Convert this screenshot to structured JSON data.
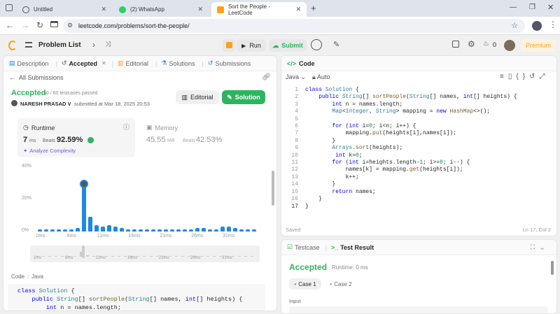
{
  "browser": {
    "tabs": [
      {
        "title": "Untitled",
        "icon": "globe-icon"
      },
      {
        "title": "(2) WhatsApp",
        "icon": "whatsapp-icon"
      },
      {
        "title": "Sort the People - LeetCode",
        "icon": "leetcode-icon"
      }
    ],
    "url": "leetcode.com/problems/sort-the-people/"
  },
  "nav": {
    "problem_list": "Problem List",
    "run": "Run",
    "submit": "Submit",
    "streak": "0",
    "premium": "Premium"
  },
  "left": {
    "tabs": [
      "Description",
      "Accepted",
      "Editorial",
      "Solutions",
      "Submissions"
    ],
    "all_submissions": "All Submissions",
    "status": "Accepted",
    "passed": "60 / 60 testcases passed",
    "user": "NARESH PRASAD V",
    "submitted": "submitted at Mar 18, 2025 20:53",
    "editorial_btn": "Editorial",
    "solution_btn": "Solution",
    "runtime_label": "Runtime",
    "runtime_value": "7",
    "runtime_unit": "ms",
    "runtime_beats_label": "Beats",
    "runtime_beats": "92.59%",
    "analyze": "Analyze Complexity",
    "memory_label": "Memory",
    "memory_value": "45.55",
    "memory_unit": "MB",
    "memory_beats_label": "Beats",
    "memory_beats": "42.53%",
    "code_label": "Code",
    "code_lang": "Java",
    "code_lines": [
      "class Solution {",
      "    public String[] sortPeople(String[] names, int[] heights) {",
      "        int n = names.length;"
    ]
  },
  "chart_data": {
    "type": "bar",
    "yticks": [
      "40%",
      "20%",
      "0%"
    ],
    "ylim": [
      0,
      40
    ],
    "xticks": [
      "1ms",
      "6ms",
      "11ms",
      "16ms",
      "21ms",
      "26ms",
      "31ms"
    ],
    "values": [
      1,
      1,
      1,
      1,
      1,
      1,
      2,
      30,
      9,
      4,
      3,
      4,
      3,
      2,
      1,
      1,
      1,
      1,
      1,
      1,
      1,
      1,
      1,
      1,
      1,
      2,
      2,
      1,
      1,
      3,
      3,
      2,
      1,
      1,
      1
    ],
    "highlight_index": 7
  },
  "editor": {
    "title": "Code",
    "lang": "Java",
    "auto": "Auto",
    "status": "Saved",
    "cursor": "Ln 17, Col 2"
  },
  "bottom": {
    "tab_testcase": "Testcase",
    "tab_result": "Test Result",
    "status": "Accepted",
    "runtime": "Runtime: 0 ms",
    "case1": "Case 1",
    "case2": "Case 2",
    "input_label": "Input"
  },
  "colors": {
    "green": "#2db55d",
    "blue": "#1e88e5",
    "orange": "#ffa116"
  }
}
